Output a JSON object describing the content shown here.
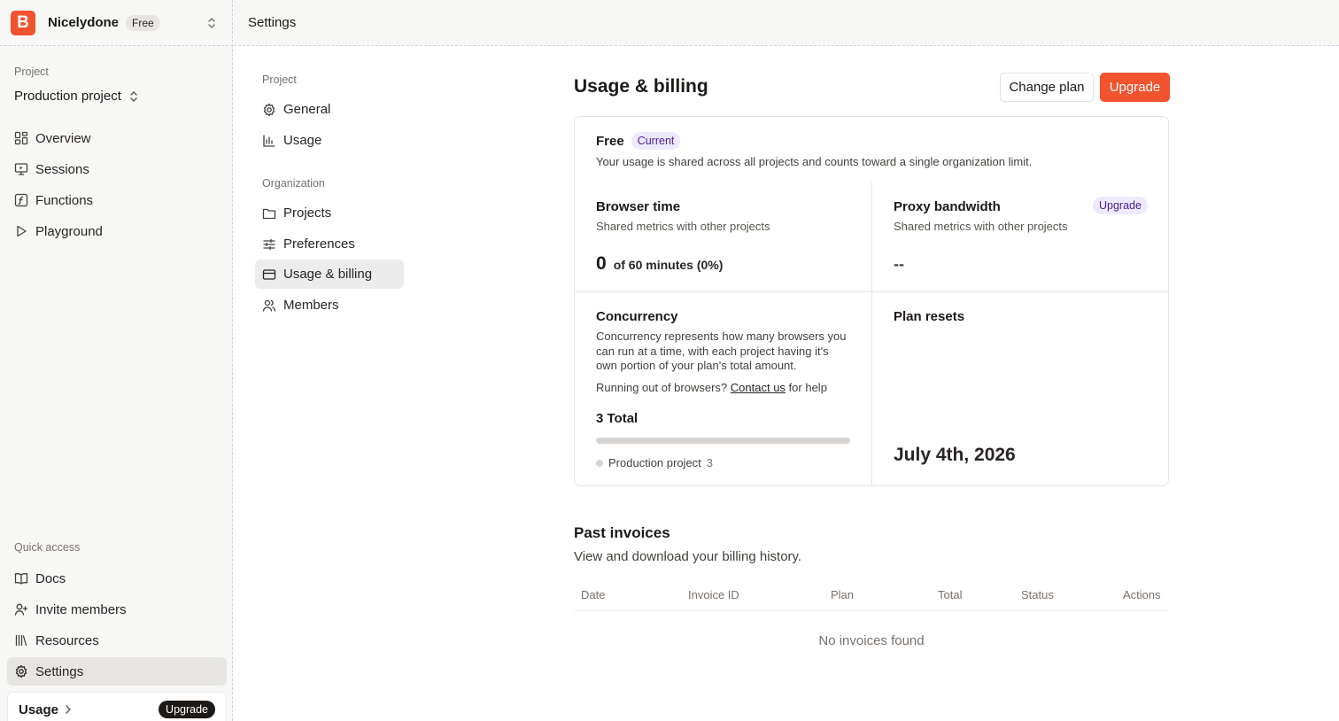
{
  "org": {
    "logo_letter": "B",
    "name": "Nicelydone",
    "plan": "Free"
  },
  "topbar": {
    "title": "Settings"
  },
  "sidebar": {
    "project_label": "Project",
    "project_name": "Production project",
    "items": [
      {
        "label": "Overview",
        "icon": "grid-icon"
      },
      {
        "label": "Sessions",
        "icon": "monitor-icon"
      },
      {
        "label": "Functions",
        "icon": "function-icon"
      },
      {
        "label": "Playground",
        "icon": "play-icon"
      }
    ],
    "quick_label": "Quick access",
    "quick_items": [
      {
        "label": "Docs",
        "icon": "book-icon"
      },
      {
        "label": "Invite members",
        "icon": "user-plus-icon"
      },
      {
        "label": "Resources",
        "icon": "library-icon"
      },
      {
        "label": "Settings",
        "icon": "gear-icon"
      }
    ],
    "usage_label": "Usage",
    "upgrade_label": "Upgrade"
  },
  "settings_nav": {
    "project_label": "Project",
    "project_items": [
      "General",
      "Usage"
    ],
    "org_label": "Organization",
    "org_items": [
      "Projects",
      "Preferences",
      "Usage & billing",
      "Members"
    ]
  },
  "main": {
    "title": "Usage & billing",
    "change_plan": "Change plan",
    "upgrade": "Upgrade",
    "plan": {
      "name": "Free",
      "badge": "Current",
      "description": "Your usage is shared across all projects and counts toward a single organization limit."
    },
    "browser_time": {
      "title": "Browser time",
      "subtitle": "Shared metrics with other projects",
      "value": "0",
      "of": "of 60 minutes (0%)"
    },
    "proxy": {
      "title": "Proxy bandwidth",
      "badge": "Upgrade",
      "subtitle": "Shared metrics with other projects",
      "value": "--"
    },
    "concurrency": {
      "title": "Concurrency",
      "description": "Concurrency represents how many browsers you can run at a time, with each project having it's own portion of your plan's total amount.",
      "help_prefix": "Running out of browsers?",
      "help_link": "Contact us",
      "help_suffix": "for help",
      "total": "3 Total",
      "bar_fraction": 1.0,
      "legend_name": "Production project",
      "legend_count": "3"
    },
    "plan_resets": {
      "title": "Plan resets",
      "date": "July 4th, 2026"
    },
    "invoices": {
      "title": "Past invoices",
      "subtitle": "View and download your billing history.",
      "columns": [
        "Date",
        "Invoice ID",
        "Plan",
        "Total",
        "Status",
        "Actions"
      ],
      "empty": "No invoices found"
    }
  },
  "colors": {
    "brand": "#f0532d",
    "badge_bg": "#ede9fe",
    "badge_text": "#4c1d95"
  }
}
